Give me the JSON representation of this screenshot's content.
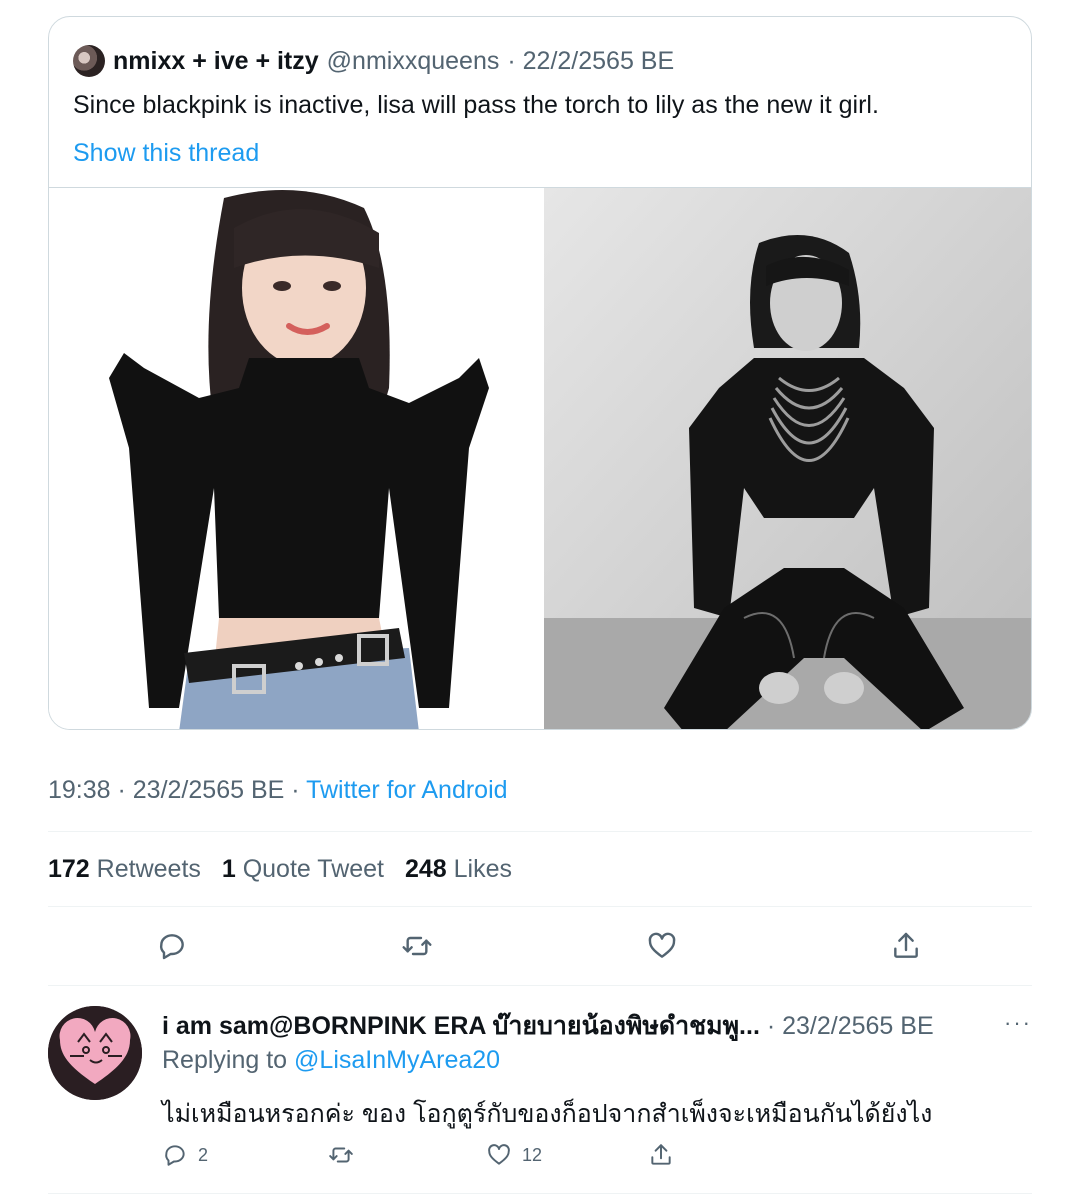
{
  "quoted_tweet": {
    "display_name": "nmixx + ive + itzy",
    "handle": "@nmixxqueens",
    "date": "· 22/2/2565 BE",
    "text": "Since blackpink is inactive, lisa will pass the torch to lily as the new it girl.",
    "show_thread": "Show this thread",
    "images": [
      "photo-woman-black-crop-top",
      "photo-woman-black-outfit-bw"
    ]
  },
  "tweet_meta": {
    "time_date": "19:38 · 23/2/2565 BE · ",
    "source": "Twitter for Android"
  },
  "stats": {
    "retweets_count": "172",
    "retweets_label": "Retweets",
    "quotes_count": "1",
    "quotes_label": "Quote Tweet",
    "likes_count": "248",
    "likes_label": "Likes"
  },
  "actions": [
    "reply-icon",
    "retweet-icon",
    "like-icon",
    "share-icon"
  ],
  "reply": {
    "display_name": "i am sam@BORNPINK ERA บ๊ายบายน้องพิษดำชมพู...",
    "date": " · 23/2/2565 BE",
    "more": "···",
    "replying_prefix": "Replying to ",
    "replying_to": "@LisaInMyArea20",
    "text": "ไม่เหมือนหรอกค่ะ ของ โอกูตูร์กับของก็อปจากสำเพ็งจะเหมือนกันได้ยังไง",
    "reply_count": "2",
    "retweet_count": "",
    "like_count": "12"
  },
  "colors": {
    "accent": "#1d9bf0",
    "secondary_text": "#536471",
    "border": "#cfd9de"
  }
}
